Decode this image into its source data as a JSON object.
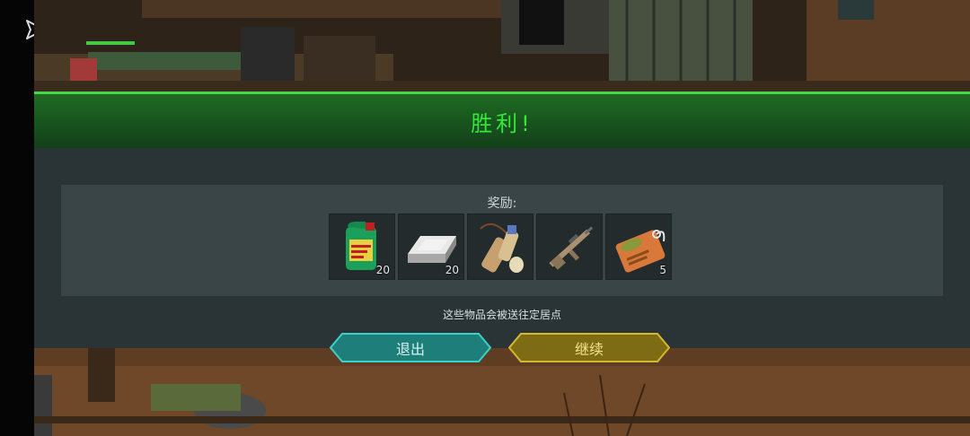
{
  "banner": {
    "title": "胜利!"
  },
  "rewards": {
    "label": "奖励:",
    "items": [
      {
        "icon": "motor-oil-can-icon",
        "count": "20"
      },
      {
        "icon": "metal-ingot-icon",
        "count": "20"
      },
      {
        "icon": "water-flask-icon",
        "count": ""
      },
      {
        "icon": "assault-rifle-icon",
        "count": ""
      },
      {
        "icon": "ammo-tag-icon",
        "count": "5"
      }
    ]
  },
  "note": "这些物品会被送往定居点",
  "buttons": {
    "exit": "退出",
    "continue": "继续"
  },
  "colors": {
    "accent_green": "#34e83a",
    "exit_button": "#1f8f8a",
    "continue_button": "#8a7a18"
  }
}
